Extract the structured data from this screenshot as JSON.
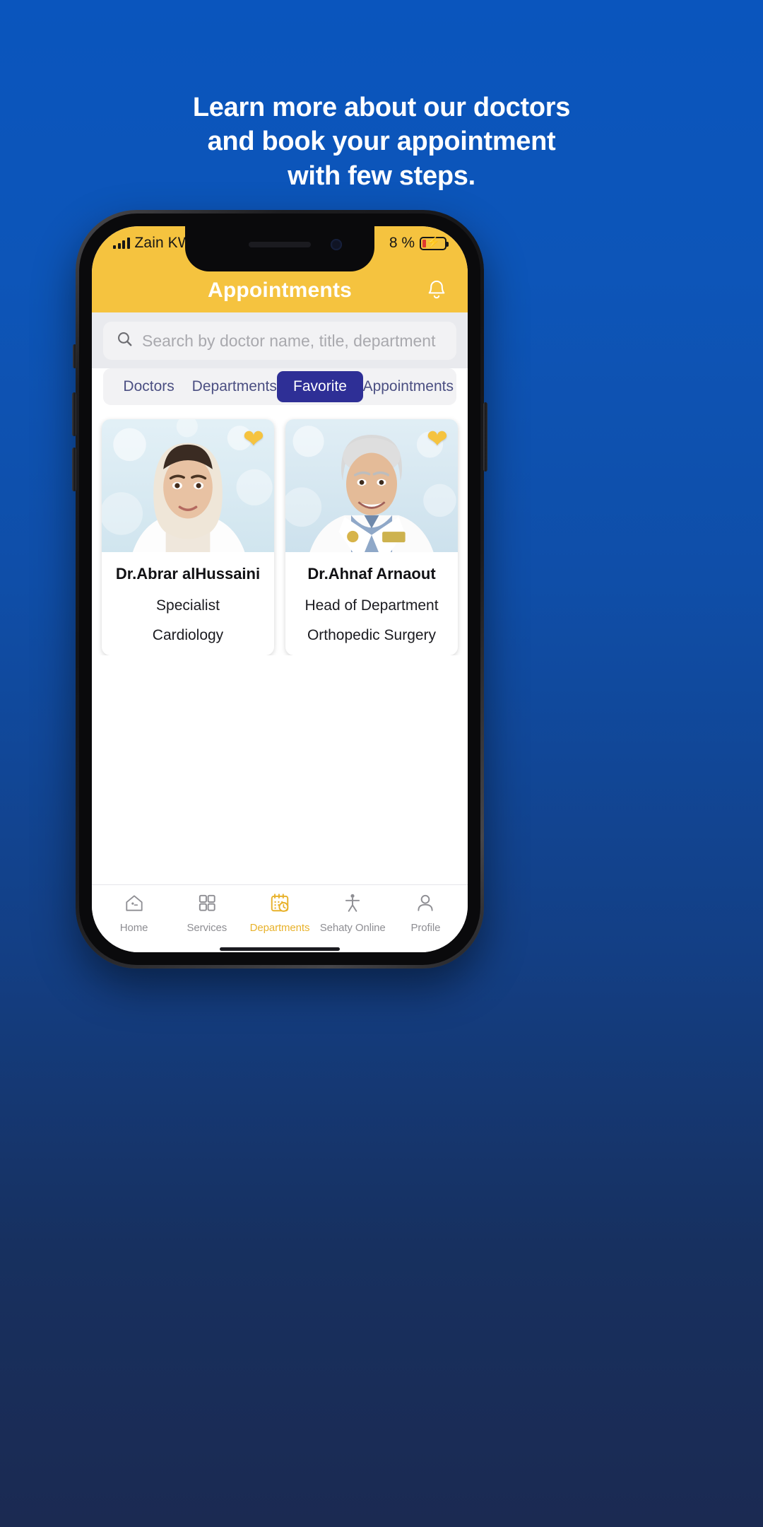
{
  "headline": {
    "line1": "Learn more about our doctors",
    "line2": "and book your appointment",
    "line3": "with few steps."
  },
  "colors": {
    "background_top": "#0a55bd",
    "background_bottom": "#1b2a52",
    "brand_yellow": "#f5c33f",
    "tab_active": "#2e2f96",
    "nav_active": "#e8b22c",
    "heart": "#f5c33f",
    "battery_fill": "#e03a2f"
  },
  "statusbar": {
    "carrier": "Zain KW",
    "signal_icon": "signal-bars-icon",
    "wifi_icon": "wifi-icon",
    "battery_text": "8 %",
    "battery_icon": "battery-charging-icon"
  },
  "appbar": {
    "title": "Appointments",
    "bell_icon": "bell-icon"
  },
  "search": {
    "placeholder": "Search by doctor name, title, department",
    "value": "",
    "icon": "search-icon"
  },
  "tabs": [
    {
      "label": "Doctors",
      "active": false
    },
    {
      "label": "Departments",
      "active": false
    },
    {
      "label": "Favorite",
      "active": true
    },
    {
      "label": "Appointments",
      "active": false
    }
  ],
  "doctors": [
    {
      "name": "Dr.Abrar alHussaini",
      "role": "Specialist",
      "department": "Cardiology",
      "favorite": true,
      "favorite_icon": "heart-filled-icon"
    },
    {
      "name": "Dr.Ahnaf Arnaout",
      "role": "Head of Department",
      "department": "Orthopedic Surgery",
      "favorite": true,
      "favorite_icon": "heart-filled-icon"
    }
  ],
  "bottom_nav": [
    {
      "label": "Home",
      "icon": "home-icon",
      "active": false
    },
    {
      "label": "Services",
      "icon": "grid-icon",
      "active": false
    },
    {
      "label": "Departments",
      "icon": "calendar-clock-icon",
      "active": true
    },
    {
      "label": "Sehaty Online",
      "icon": "person-activity-icon",
      "active": false
    },
    {
      "label": "Profile",
      "icon": "user-icon",
      "active": false
    }
  ]
}
